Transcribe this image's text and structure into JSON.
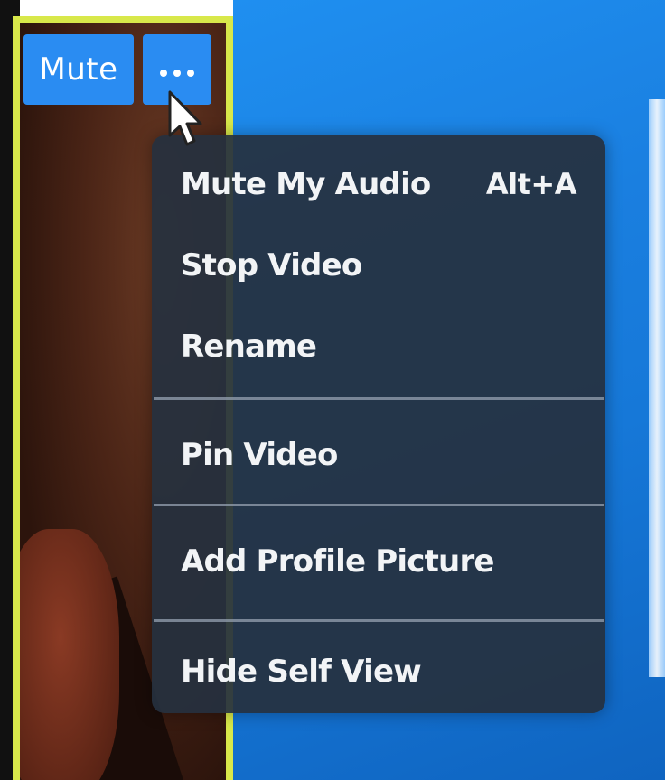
{
  "tile": {
    "mute_label": "Mute",
    "more_label": "..."
  },
  "menu": {
    "items": [
      {
        "label": "Mute My Audio",
        "shortcut": "Alt+A"
      },
      {
        "label": "Stop Video"
      },
      {
        "label": "Rename"
      },
      {
        "label": "Pin Video"
      },
      {
        "label": "Add Profile Picture"
      },
      {
        "label": "Hide Self View"
      }
    ]
  },
  "colors": {
    "button_blue": "#2a8cf2",
    "active_speaker_border": "#d8e84a",
    "menu_background": "#26303e",
    "menu_text": "#f2f4f6"
  },
  "icons": {
    "more": "more-dots-icon",
    "cursor": "mouse-pointer-icon"
  }
}
